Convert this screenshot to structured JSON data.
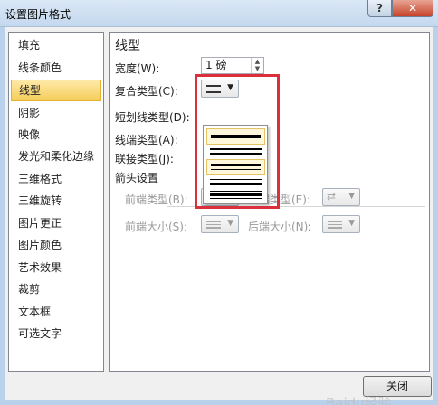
{
  "window": {
    "title": "设置图片格式",
    "help_label": "?",
    "close_label": "✕"
  },
  "nav": {
    "items": [
      {
        "label": "填充"
      },
      {
        "label": "线条颜色"
      },
      {
        "label": "线型",
        "selected": true
      },
      {
        "label": "阴影"
      },
      {
        "label": "映像"
      },
      {
        "label": "发光和柔化边缘"
      },
      {
        "label": "三维格式"
      },
      {
        "label": "三维旋转"
      },
      {
        "label": "图片更正"
      },
      {
        "label": "图片颜色"
      },
      {
        "label": "艺术效果"
      },
      {
        "label": "裁剪"
      },
      {
        "label": "文本框"
      },
      {
        "label": "可选文字"
      }
    ]
  },
  "panel": {
    "heading": "线型",
    "width_label": "宽度(W):",
    "width_value": "1 磅",
    "compound_label": "复合类型(C):",
    "dash_label": "短划线类型(D):",
    "cap_label": "线端类型(A):",
    "join_label": "联接类型(J):",
    "arrow_section": "箭头设置",
    "begin_type_label": "前端类型(B):",
    "end_type_label": "后端类型(E):",
    "begin_size_label": "前端大小(S):",
    "end_size_label": "后端大小(N):"
  },
  "compound_options": [
    {
      "name": "single"
    },
    {
      "name": "double"
    },
    {
      "name": "thick-thin"
    },
    {
      "name": "thin-thick"
    },
    {
      "name": "triple"
    }
  ],
  "footer": {
    "close_button": "关闭"
  },
  "watermark": "Baidu经验",
  "colors": {
    "selected_nav": "#f6cd5a",
    "highlight_box": "#d9303b",
    "close_button_red": "#c7442b"
  }
}
